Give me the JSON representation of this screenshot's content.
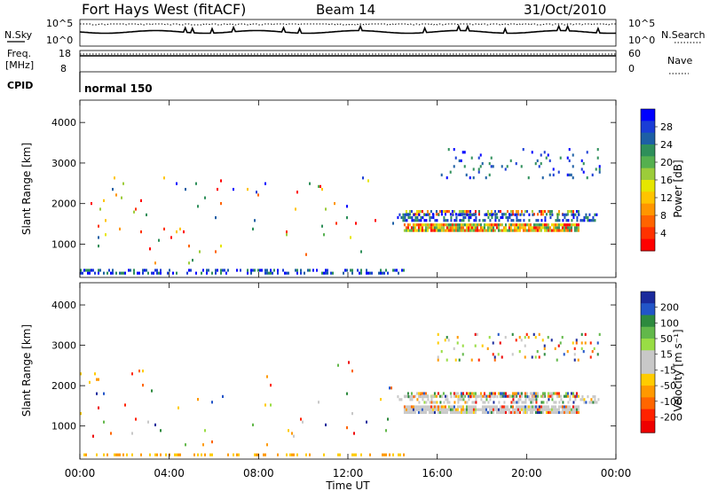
{
  "header": {
    "station": "Fort Hays West (fitACF)",
    "beam": "Beam 14",
    "date": "31/Oct/2010"
  },
  "top_panels": {
    "nsky_label": "N.Sky",
    "nsearch_label": "N.Search",
    "nsky_ticks": [
      "10^5",
      "10^0"
    ],
    "nsearch_ticks": [
      "10^5",
      "10^0"
    ],
    "freq_label_1": "Freq.",
    "freq_label_2": "[MHz]",
    "freq_ticks": [
      "18",
      "8"
    ],
    "nave_label": "Nave",
    "nave_ticks": [
      "60",
      "0"
    ],
    "cpid_label": "CPID",
    "cpid_value": "normal 150"
  },
  "chart_data": [
    {
      "type": "heatmap",
      "name": "power",
      "ylabel": "Slant Range [km]",
      "xlabel": "Time UT",
      "x_ticks": [
        "00:00",
        "04:00",
        "08:00",
        "12:00",
        "16:00",
        "20:00",
        "00:00"
      ],
      "y_ticks": [
        1000,
        2000,
        3000,
        4000
      ],
      "xlim_hours": [
        0,
        24
      ],
      "ylim_km": [
        180,
        4550
      ],
      "colorbar": {
        "label": "Power [dB]",
        "ticks": [
          "28",
          "24",
          "20",
          "16",
          "12",
          "8",
          "4"
        ],
        "colors": [
          "#0000ff",
          "#1a3dd6",
          "#1d5fa5",
          "#2e8f5a",
          "#55b04f",
          "#9ccc3a",
          "#e6e600",
          "#ffc400",
          "#ff9600",
          "#ff6400",
          "#ff3200",
          "#ff0000"
        ]
      },
      "regions": [
        {
          "t": [
            14.5,
            22.3
          ],
          "r": [
            1300,
            1500
          ],
          "density": 0.9,
          "level": "high"
        },
        {
          "t": [
            14.5,
            22.3
          ],
          "r": [
            1700,
            1800
          ],
          "density": 0.6,
          "level": "mixed"
        },
        {
          "t": [
            14.2,
            23.2
          ],
          "r": [
            1550,
            1700
          ],
          "density": 0.4,
          "level": "low"
        },
        {
          "t": [
            16,
            23.3
          ],
          "r": [
            2600,
            3300
          ],
          "density": 0.08,
          "level": "low"
        },
        {
          "t": [
            0,
            14.5
          ],
          "r": [
            250,
            320
          ],
          "density": 0.35,
          "level": "low"
        },
        {
          "t": [
            0,
            14
          ],
          "r": [
            500,
            2600
          ],
          "density": 0.012,
          "level": "mixed"
        }
      ]
    },
    {
      "type": "heatmap",
      "name": "velocity",
      "ylabel": "Slant Range [km]",
      "xlabel": "Time UT",
      "x_ticks": [
        "00:00",
        "04:00",
        "08:00",
        "12:00",
        "16:00",
        "20:00",
        "00:00"
      ],
      "y_ticks": [
        1000,
        2000,
        3000,
        4000
      ],
      "xlim_hours": [
        0,
        24
      ],
      "ylim_km": [
        180,
        4550
      ],
      "colorbar": {
        "label": "Velocity [m s⁻¹]",
        "ticks": [
          "200",
          "100",
          "50",
          "15",
          "-15",
          "-50",
          "-100",
          "-200"
        ],
        "colors": [
          "#1a2a9c",
          "#2255c8",
          "#2d8a3e",
          "#62b84a",
          "#99dd44",
          "#c8c8c8",
          "#c8c8c8",
          "#ffcc00",
          "#ff9900",
          "#ff6600",
          "#ff2200",
          "#ee0000"
        ]
      },
      "regions": [
        {
          "t": [
            14.5,
            22.3
          ],
          "r": [
            1300,
            1500
          ],
          "density": 0.9,
          "level": "ground"
        },
        {
          "t": [
            14.5,
            22.3
          ],
          "r": [
            1700,
            1800
          ],
          "density": 0.6,
          "level": "mixed"
        },
        {
          "t": [
            14.2,
            23.2
          ],
          "r": [
            1550,
            1700
          ],
          "density": 0.4,
          "level": "ground"
        },
        {
          "t": [
            16,
            23.3
          ],
          "r": [
            2600,
            3300
          ],
          "density": 0.08,
          "level": "mixed"
        },
        {
          "t": [
            0,
            14.5
          ],
          "r": [
            250,
            320
          ],
          "density": 0.35,
          "level": "neg"
        },
        {
          "t": [
            0,
            14
          ],
          "r": [
            500,
            2600
          ],
          "density": 0.012,
          "level": "mixed"
        }
      ]
    }
  ]
}
